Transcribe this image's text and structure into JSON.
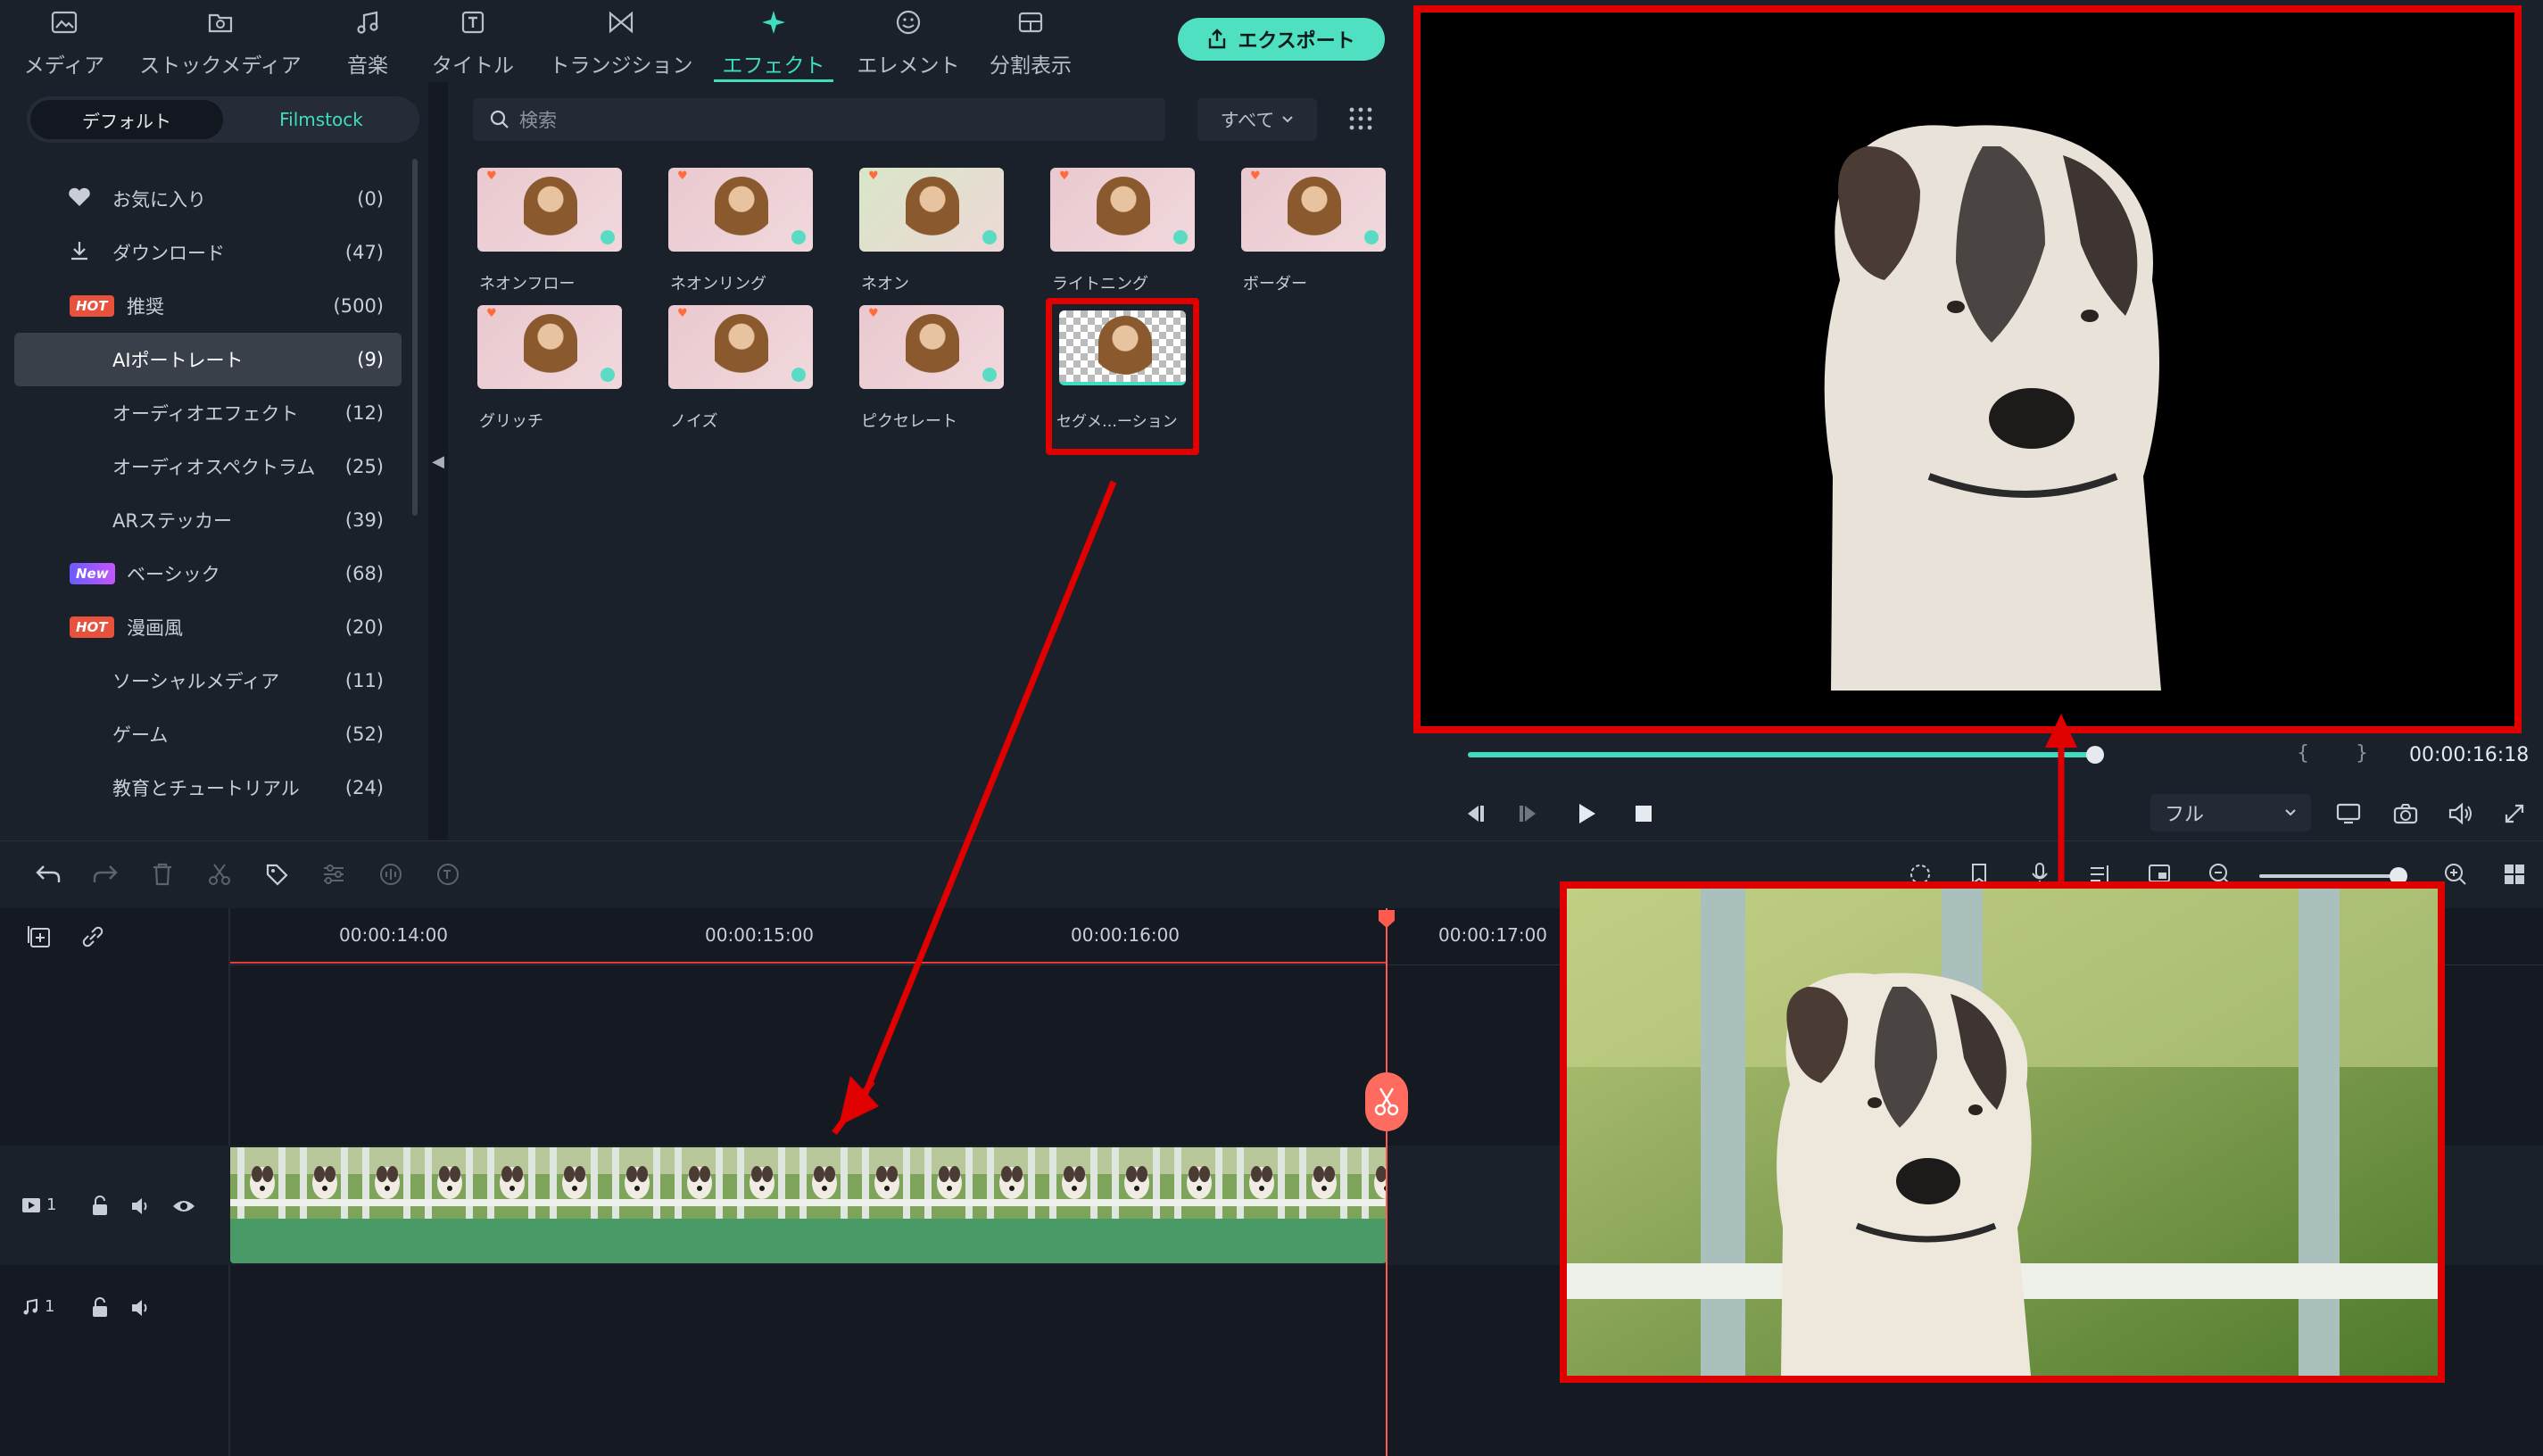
{
  "nav": {
    "tabs": [
      {
        "label": "メディア",
        "icon": "media-icon"
      },
      {
        "label": "ストックメディア",
        "icon": "stock-media-icon"
      },
      {
        "label": "音楽",
        "icon": "music-icon"
      },
      {
        "label": "タイトル",
        "icon": "title-icon"
      },
      {
        "label": "トランジション",
        "icon": "transition-icon"
      },
      {
        "label": "エフェクト",
        "icon": "effects-icon",
        "active": true
      },
      {
        "label": "エレメント",
        "icon": "elements-icon"
      },
      {
        "label": "分割表示",
        "icon": "split-screen-icon"
      }
    ],
    "export_label": "エクスポート"
  },
  "sidebar": {
    "seg_default": "デフォルト",
    "seg_filmstock": "Filmstock",
    "items": [
      {
        "label": "お気に入り",
        "count": "(0)",
        "icon": "heart-icon"
      },
      {
        "label": "ダウンロード",
        "count": "(47)",
        "icon": "download-icon"
      },
      {
        "label": "推奨",
        "count": "(500)",
        "badge": "HOT"
      },
      {
        "label": "AIポートレート",
        "count": "(9)",
        "selected": true
      },
      {
        "label": "オーディオエフェクト",
        "count": "(12)"
      },
      {
        "label": "オーディオスペクトラム",
        "count": "(25)"
      },
      {
        "label": "ARステッカー",
        "count": "(39)"
      },
      {
        "label": "ベーシック",
        "count": "(68)",
        "badge": "New"
      },
      {
        "label": "漫画風",
        "count": "(20)",
        "badge": "HOT"
      },
      {
        "label": "ソーシャルメディア",
        "count": "(11)"
      },
      {
        "label": "ゲーム",
        "count": "(52)"
      },
      {
        "label": "教育とチュートリアル",
        "count": "(24)"
      }
    ]
  },
  "effects": {
    "search_placeholder": "検索",
    "filter_label": "すべて",
    "items": [
      {
        "label": "ネオンフロー"
      },
      {
        "label": "ネオンリング"
      },
      {
        "label": "ネオン"
      },
      {
        "label": "ライトニング"
      },
      {
        "label": "ボーダー"
      },
      {
        "label": "グリッチ"
      },
      {
        "label": "ノイズ"
      },
      {
        "label": "ピクセレート"
      },
      {
        "label": "セグメ…ーション",
        "highlighted": true
      }
    ]
  },
  "preview": {
    "timecode": "00:00:16:18",
    "quality": "フル",
    "progress": 0.81
  },
  "timeline": {
    "ruler": [
      "00:00:14:00",
      "00:00:15:00",
      "00:00:16:00",
      "00:00:17:00"
    ],
    "video_track_label": "1",
    "audio_track_label": "1"
  },
  "colors": {
    "accent": "#3fdcc0",
    "highlight": "#e10000",
    "playhead": "#ff5a4e",
    "clip": "#4a9a68"
  }
}
